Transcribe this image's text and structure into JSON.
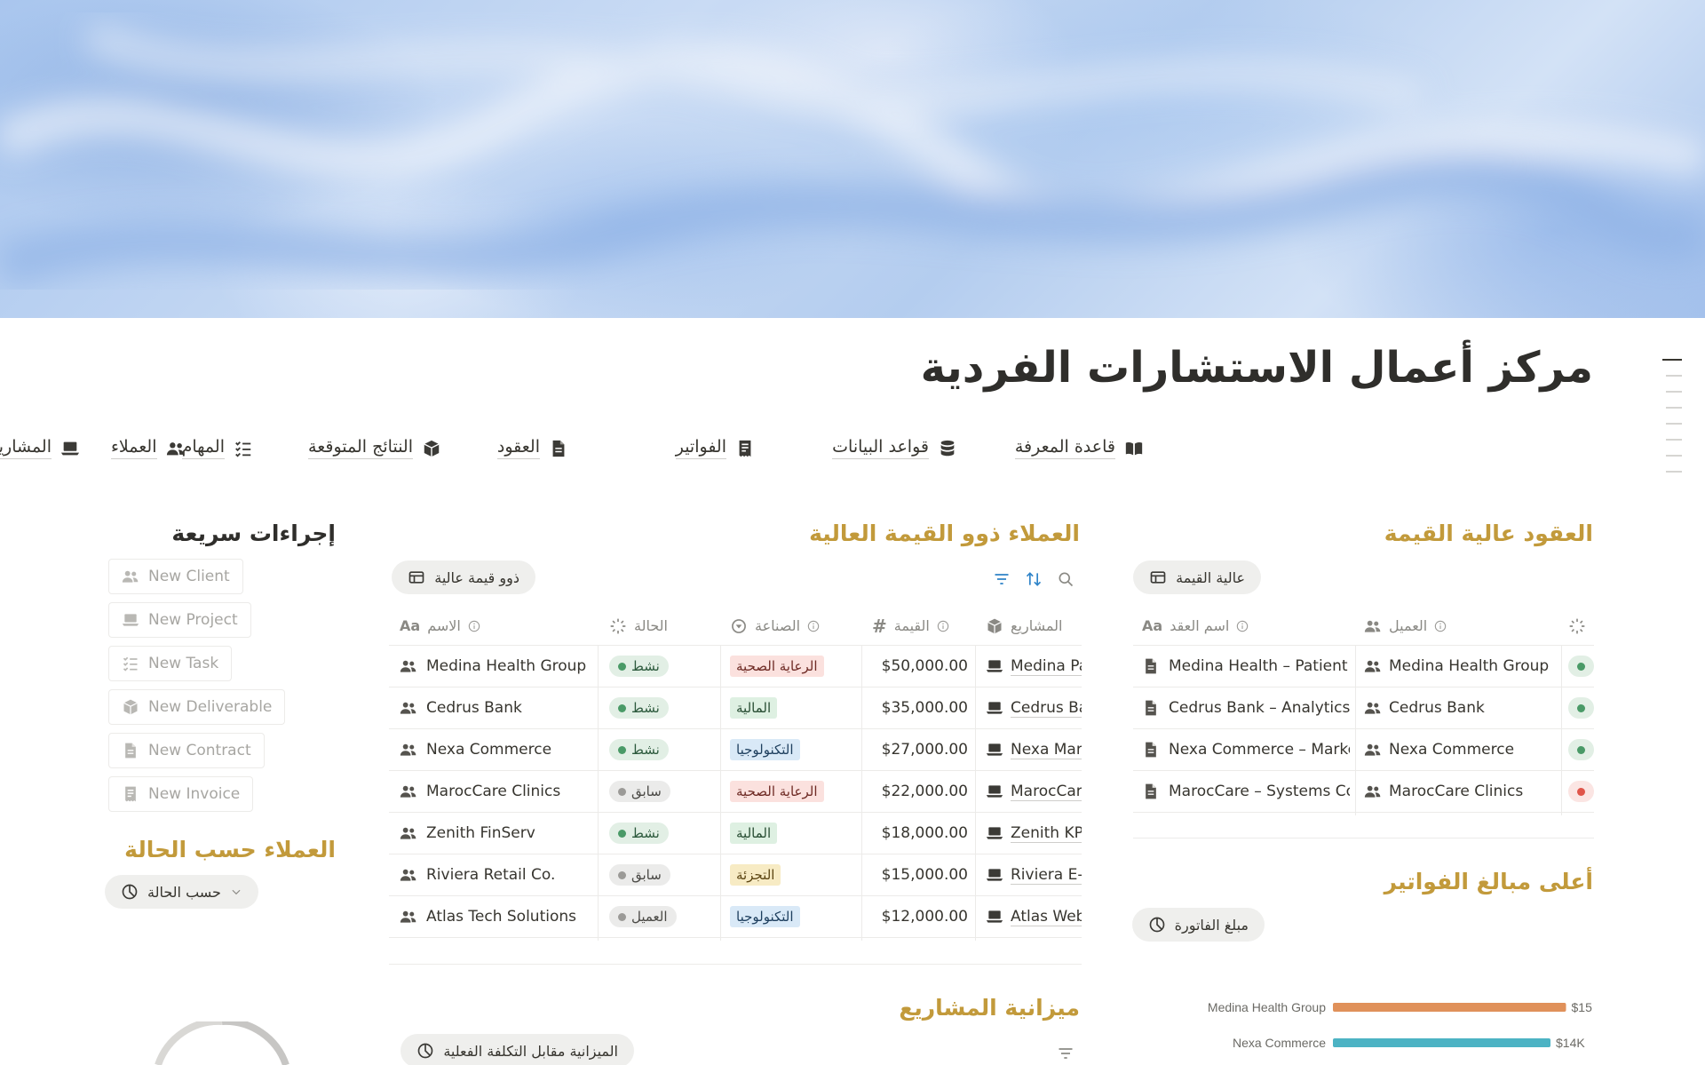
{
  "page": {
    "title": "مركز أعمال الاستشارات الفردية"
  },
  "nav": [
    {
      "label": "قاعدة المعرفة",
      "icon": "book-icon"
    },
    {
      "label": "قواعد البيانات",
      "icon": "database-icon"
    },
    {
      "label": "الفواتير",
      "icon": "receipt-icon"
    },
    {
      "label": "العقود",
      "icon": "document-icon"
    },
    {
      "label": "النتائج المتوقعة",
      "icon": "package-icon"
    },
    {
      "label": "المهام",
      "icon": "checklist-icon"
    },
    {
      "label": "المشاريع",
      "icon": "laptop-icon"
    },
    {
      "label": "العملاء",
      "icon": "people-icon"
    }
  ],
  "contracts": {
    "title": "العقود عالية القيمة",
    "view": "عالية القيمة",
    "headers": {
      "name": "اسم العقد",
      "client": "العميل"
    },
    "rows": [
      {
        "name": "Medina Health – Patient Po",
        "client": "Medina Health Group",
        "status": "green"
      },
      {
        "name": "Cedrus Bank – Analytics R",
        "client": "Cedrus Bank",
        "status": "green"
      },
      {
        "name": "Nexa Commerce – Market",
        "client": "Nexa Commerce",
        "status": "green"
      },
      {
        "name": "MarocCare – Systems Cor",
        "client": "MarocCare Clinics",
        "status": "red"
      }
    ]
  },
  "clients": {
    "title": "العملاء ذوو القيمة العالية",
    "view": "ذوو قيمة عالية",
    "headers": {
      "name": "الاسم",
      "status": "الحالة",
      "industry": "الصناعة",
      "value": "القيمة",
      "projects": "المشاريع"
    },
    "rows": [
      {
        "name": "Medina Health Group",
        "status": "نشط",
        "status_color": "green",
        "industry": "الرعاية الصحية",
        "industry_color": "red",
        "value": "$50,000.00",
        "project": "Medina Pa"
      },
      {
        "name": "Cedrus Bank",
        "status": "نشط",
        "status_color": "green",
        "industry": "المالية",
        "industry_color": "green",
        "value": "$35,000.00",
        "project": "Cedrus Ba"
      },
      {
        "name": "Nexa Commerce",
        "status": "نشط",
        "status_color": "green",
        "industry": "التكنولوجيا",
        "industry_color": "blue",
        "value": "$27,000.00",
        "project": "Nexa Mari"
      },
      {
        "name": "MarocCare Clinics",
        "status": "سابق",
        "status_color": "gray",
        "industry": "الرعاية الصحية",
        "industry_color": "red",
        "value": "$22,000.00",
        "project": "MarocCar"
      },
      {
        "name": "Zenith FinServ",
        "status": "نشط",
        "status_color": "green",
        "industry": "المالية",
        "industry_color": "green",
        "value": "$18,000.00",
        "project": "Zenith KP"
      },
      {
        "name": "Riviera Retail Co.",
        "status": "سابق",
        "status_color": "gray",
        "industry": "التجزئة",
        "industry_color": "yellow",
        "value": "$15,000.00",
        "project": "Riviera E-"
      },
      {
        "name": "Atlas Tech Solutions",
        "status": "العميل",
        "status_color": "gray",
        "industry": "التكنولوجيا",
        "industry_color": "blue",
        "value": "$12,000.00",
        "project": "Atlas Web"
      }
    ]
  },
  "quick_actions": {
    "title": "إجراءات سريعة",
    "items": [
      {
        "label": "New Client",
        "icon": "people-icon"
      },
      {
        "label": "New Project",
        "icon": "laptop-icon"
      },
      {
        "label": "New Task",
        "icon": "checklist-icon"
      },
      {
        "label": "New Deliverable",
        "icon": "package-icon"
      },
      {
        "label": "New Contract",
        "icon": "document-icon"
      },
      {
        "label": "New Invoice",
        "icon": "receipt-icon"
      }
    ]
  },
  "clients_by_status": {
    "title": "العملاء حسب الحالة",
    "view": "حسب الحالة"
  },
  "invoices": {
    "title": "أعلى مبالغ الفواتير",
    "view": "مبلغ الفاتورة"
  },
  "project_budget": {
    "title": "ميزانية المشاريع",
    "view": "الميزانية مقابل التكلفة الفعلية"
  },
  "colors": {
    "accent_heading": "#c29a3b",
    "bar_orange": "#e0915a",
    "bar_teal": "#4cb3c4"
  },
  "chart_data": {
    "type": "bar",
    "orientation": "horizontal",
    "categories": [
      "Medina Health Group",
      "Nexa Commerce"
    ],
    "values": [
      15000,
      14000
    ],
    "value_labels": [
      "$15",
      "$14K"
    ],
    "colors": [
      "#e0915a",
      "#4cb3c4"
    ],
    "xlim": [
      0,
      16000
    ]
  }
}
